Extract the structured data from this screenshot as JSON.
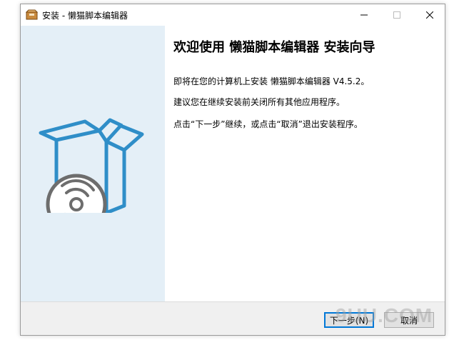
{
  "window": {
    "title": "安装 - 懒猫脚本编辑器"
  },
  "icons": {
    "app": "installer-box-icon",
    "minimize": "minimize-icon",
    "maximize": "maximize-icon",
    "close": "close-icon",
    "illustration": "software-box-disc-icon"
  },
  "colors": {
    "sidebar_bg": "#e4eff7",
    "box_stroke": "#2f8ec8",
    "disc_gray": "#6d6d6d",
    "default_button_border": "#0078d7",
    "footer_bg": "#f0f0f0"
  },
  "content": {
    "heading": "欢迎使用 懒猫脚本编辑器 安装向导",
    "line1": "即将在您的计算机上安装 懒猫脚本编辑器 V4.5.2。",
    "line2": "建议您在继续安装前关闭所有其他应用程序。",
    "line3": "点击“下一步”继续，或点击“取消”退出安装程序。"
  },
  "buttons": {
    "next": "下一步(N)",
    "cancel": "取消"
  },
  "watermark": "9UU.COM"
}
